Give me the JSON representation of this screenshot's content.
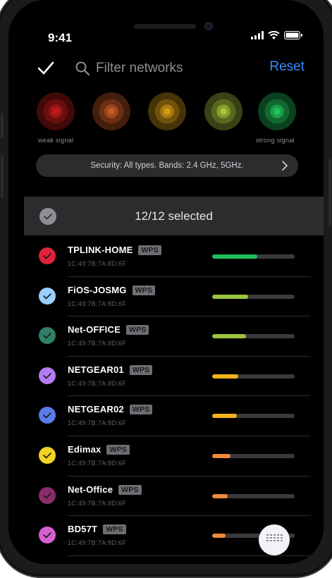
{
  "status": {
    "time": "9:41"
  },
  "toolbar": {
    "search_placeholder": "Filter networks",
    "reset_label": "Reset"
  },
  "signal_legend": {
    "weak_label": "weak signal",
    "strong_label": "strong signal",
    "colors": [
      "#c41a1a",
      "#c85a24",
      "#d39a14",
      "#a8c43a",
      "#20c45a"
    ]
  },
  "filter_summary": "Security: All types. Bands: 2.4 GHz, 5GHz.",
  "selection": {
    "label": "12/12 selected"
  },
  "networks": [
    {
      "name": "TPLINK-HOME",
      "badge": "WPS",
      "mac": "1C:49:7B:7A:8D:6F",
      "color": "#e0233a",
      "signal": 0.55,
      "signal_color": "#1fbf5a"
    },
    {
      "name": "FiOS-JOSMG",
      "badge": "WPS",
      "mac": "1C:49:7B:7A:8D:6F",
      "color": "#9ad0ff",
      "signal": 0.44,
      "signal_color": "#9bc441"
    },
    {
      "name": "Net-OFFICE",
      "badge": "WPS",
      "mac": "1C:49:7B:7A:8D:6F",
      "color": "#2f7f6a",
      "signal": 0.41,
      "signal_color": "#9bc441"
    },
    {
      "name": "NETGEAR01",
      "badge": "WPS",
      "mac": "1C:49:7B:7A:8D:6F",
      "color": "#b57bf0",
      "signal": 0.32,
      "signal_color": "#f2b21b"
    },
    {
      "name": "NETGEAR02",
      "badge": "WPS",
      "mac": "1C:49:7B:7A:8D:6F",
      "color": "#5b7be6",
      "signal": 0.3,
      "signal_color": "#f2b21b"
    },
    {
      "name": "Edimax",
      "badge": "WPS",
      "mac": "1C:49:7B:7A:8D:6F",
      "color": "#f2d321",
      "signal": 0.22,
      "signal_color": "#ef8a3a"
    },
    {
      "name": "Net-Office",
      "badge": "WPS",
      "mac": "1C:49:7B:7A:8D:6F",
      "color": "#8a2c6b",
      "signal": 0.19,
      "signal_color": "#ef8a3a"
    },
    {
      "name": "BD57T",
      "badge": "WPS",
      "mac": "1C:49:7B:7A:8D:6F",
      "color": "#d85fd0",
      "signal": 0.16,
      "signal_color": "#ef8a3a"
    }
  ]
}
